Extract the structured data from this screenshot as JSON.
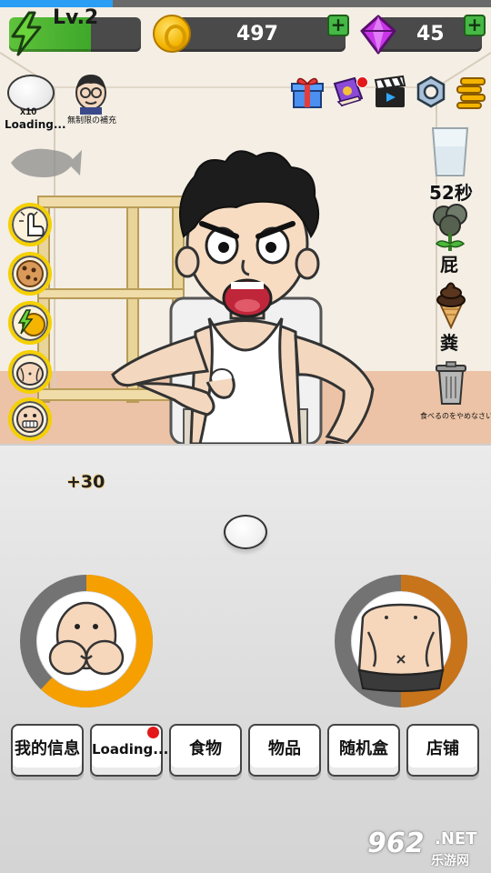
{
  "hud": {
    "top_progress_fraction": 0.23,
    "level_label": "Lv.2",
    "coins": "497",
    "gems": "45",
    "plus_symbol": "+",
    "colors": {
      "level_green": "#5ec23b",
      "coin_gold": "#f4b400",
      "gem_purple": "#c836e8",
      "plus_green": "#45b845"
    }
  },
  "left_panel": {
    "egg_count": "x10",
    "egg_status": "Loading...",
    "grandpa_label": "無制限の補充",
    "skills": [
      {
        "icon": "finger-point-icon"
      },
      {
        "icon": "cookie-icon"
      },
      {
        "icon": "lightning-fruit-icon"
      },
      {
        "icon": "belly-pinch-icon"
      },
      {
        "icon": "grinning-face-icon"
      }
    ]
  },
  "top_right_icons": [
    "gift-icon",
    "book-icon",
    "clapperboard-icon",
    "hex-nut-icon",
    "coin-stack-icon"
  ],
  "right_panel": {
    "water_timer": "52秒",
    "fart_label": "屁",
    "poop_label": "粪",
    "trash_label": "食べるのをやめなさい"
  },
  "counter": {
    "bonus_popup": "+30",
    "gauges": [
      {
        "name": "cheeks",
        "fill_fraction": 0.62,
        "color": "#f5a000"
      },
      {
        "name": "belly",
        "fill_fraction": 0.5,
        "color": "#c8741a"
      }
    ]
  },
  "menu": {
    "buttons": [
      "我的信息",
      "Loading...",
      "食物",
      "物品",
      "随机盒",
      "店铺"
    ]
  },
  "watermark": {
    "number": "962",
    "suffix": ".NET",
    "site_name": "乐游网"
  }
}
